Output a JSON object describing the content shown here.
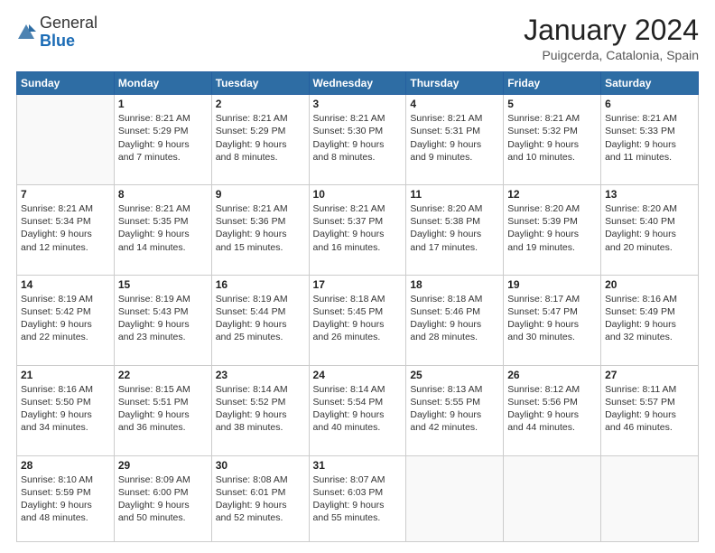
{
  "logo": {
    "general": "General",
    "blue": "Blue"
  },
  "title": "January 2024",
  "location": "Puigcerda, Catalonia, Spain",
  "days": [
    "Sunday",
    "Monday",
    "Tuesday",
    "Wednesday",
    "Thursday",
    "Friday",
    "Saturday"
  ],
  "weeks": [
    [
      {
        "day": "",
        "lines": []
      },
      {
        "day": "1",
        "lines": [
          "Sunrise: 8:21 AM",
          "Sunset: 5:29 PM",
          "Daylight: 9 hours",
          "and 7 minutes."
        ]
      },
      {
        "day": "2",
        "lines": [
          "Sunrise: 8:21 AM",
          "Sunset: 5:29 PM",
          "Daylight: 9 hours",
          "and 8 minutes."
        ]
      },
      {
        "day": "3",
        "lines": [
          "Sunrise: 8:21 AM",
          "Sunset: 5:30 PM",
          "Daylight: 9 hours",
          "and 8 minutes."
        ]
      },
      {
        "day": "4",
        "lines": [
          "Sunrise: 8:21 AM",
          "Sunset: 5:31 PM",
          "Daylight: 9 hours",
          "and 9 minutes."
        ]
      },
      {
        "day": "5",
        "lines": [
          "Sunrise: 8:21 AM",
          "Sunset: 5:32 PM",
          "Daylight: 9 hours",
          "and 10 minutes."
        ]
      },
      {
        "day": "6",
        "lines": [
          "Sunrise: 8:21 AM",
          "Sunset: 5:33 PM",
          "Daylight: 9 hours",
          "and 11 minutes."
        ]
      }
    ],
    [
      {
        "day": "7",
        "lines": [
          "Sunrise: 8:21 AM",
          "Sunset: 5:34 PM",
          "Daylight: 9 hours",
          "and 12 minutes."
        ]
      },
      {
        "day": "8",
        "lines": [
          "Sunrise: 8:21 AM",
          "Sunset: 5:35 PM",
          "Daylight: 9 hours",
          "and 14 minutes."
        ]
      },
      {
        "day": "9",
        "lines": [
          "Sunrise: 8:21 AM",
          "Sunset: 5:36 PM",
          "Daylight: 9 hours",
          "and 15 minutes."
        ]
      },
      {
        "day": "10",
        "lines": [
          "Sunrise: 8:21 AM",
          "Sunset: 5:37 PM",
          "Daylight: 9 hours",
          "and 16 minutes."
        ]
      },
      {
        "day": "11",
        "lines": [
          "Sunrise: 8:20 AM",
          "Sunset: 5:38 PM",
          "Daylight: 9 hours",
          "and 17 minutes."
        ]
      },
      {
        "day": "12",
        "lines": [
          "Sunrise: 8:20 AM",
          "Sunset: 5:39 PM",
          "Daylight: 9 hours",
          "and 19 minutes."
        ]
      },
      {
        "day": "13",
        "lines": [
          "Sunrise: 8:20 AM",
          "Sunset: 5:40 PM",
          "Daylight: 9 hours",
          "and 20 minutes."
        ]
      }
    ],
    [
      {
        "day": "14",
        "lines": [
          "Sunrise: 8:19 AM",
          "Sunset: 5:42 PM",
          "Daylight: 9 hours",
          "and 22 minutes."
        ]
      },
      {
        "day": "15",
        "lines": [
          "Sunrise: 8:19 AM",
          "Sunset: 5:43 PM",
          "Daylight: 9 hours",
          "and 23 minutes."
        ]
      },
      {
        "day": "16",
        "lines": [
          "Sunrise: 8:19 AM",
          "Sunset: 5:44 PM",
          "Daylight: 9 hours",
          "and 25 minutes."
        ]
      },
      {
        "day": "17",
        "lines": [
          "Sunrise: 8:18 AM",
          "Sunset: 5:45 PM",
          "Daylight: 9 hours",
          "and 26 minutes."
        ]
      },
      {
        "day": "18",
        "lines": [
          "Sunrise: 8:18 AM",
          "Sunset: 5:46 PM",
          "Daylight: 9 hours",
          "and 28 minutes."
        ]
      },
      {
        "day": "19",
        "lines": [
          "Sunrise: 8:17 AM",
          "Sunset: 5:47 PM",
          "Daylight: 9 hours",
          "and 30 minutes."
        ]
      },
      {
        "day": "20",
        "lines": [
          "Sunrise: 8:16 AM",
          "Sunset: 5:49 PM",
          "Daylight: 9 hours",
          "and 32 minutes."
        ]
      }
    ],
    [
      {
        "day": "21",
        "lines": [
          "Sunrise: 8:16 AM",
          "Sunset: 5:50 PM",
          "Daylight: 9 hours",
          "and 34 minutes."
        ]
      },
      {
        "day": "22",
        "lines": [
          "Sunrise: 8:15 AM",
          "Sunset: 5:51 PM",
          "Daylight: 9 hours",
          "and 36 minutes."
        ]
      },
      {
        "day": "23",
        "lines": [
          "Sunrise: 8:14 AM",
          "Sunset: 5:52 PM",
          "Daylight: 9 hours",
          "and 38 minutes."
        ]
      },
      {
        "day": "24",
        "lines": [
          "Sunrise: 8:14 AM",
          "Sunset: 5:54 PM",
          "Daylight: 9 hours",
          "and 40 minutes."
        ]
      },
      {
        "day": "25",
        "lines": [
          "Sunrise: 8:13 AM",
          "Sunset: 5:55 PM",
          "Daylight: 9 hours",
          "and 42 minutes."
        ]
      },
      {
        "day": "26",
        "lines": [
          "Sunrise: 8:12 AM",
          "Sunset: 5:56 PM",
          "Daylight: 9 hours",
          "and 44 minutes."
        ]
      },
      {
        "day": "27",
        "lines": [
          "Sunrise: 8:11 AM",
          "Sunset: 5:57 PM",
          "Daylight: 9 hours",
          "and 46 minutes."
        ]
      }
    ],
    [
      {
        "day": "28",
        "lines": [
          "Sunrise: 8:10 AM",
          "Sunset: 5:59 PM",
          "Daylight: 9 hours",
          "and 48 minutes."
        ]
      },
      {
        "day": "29",
        "lines": [
          "Sunrise: 8:09 AM",
          "Sunset: 6:00 PM",
          "Daylight: 9 hours",
          "and 50 minutes."
        ]
      },
      {
        "day": "30",
        "lines": [
          "Sunrise: 8:08 AM",
          "Sunset: 6:01 PM",
          "Daylight: 9 hours",
          "and 52 minutes."
        ]
      },
      {
        "day": "31",
        "lines": [
          "Sunrise: 8:07 AM",
          "Sunset: 6:03 PM",
          "Daylight: 9 hours",
          "and 55 minutes."
        ]
      },
      {
        "day": "",
        "lines": []
      },
      {
        "day": "",
        "lines": []
      },
      {
        "day": "",
        "lines": []
      }
    ]
  ]
}
